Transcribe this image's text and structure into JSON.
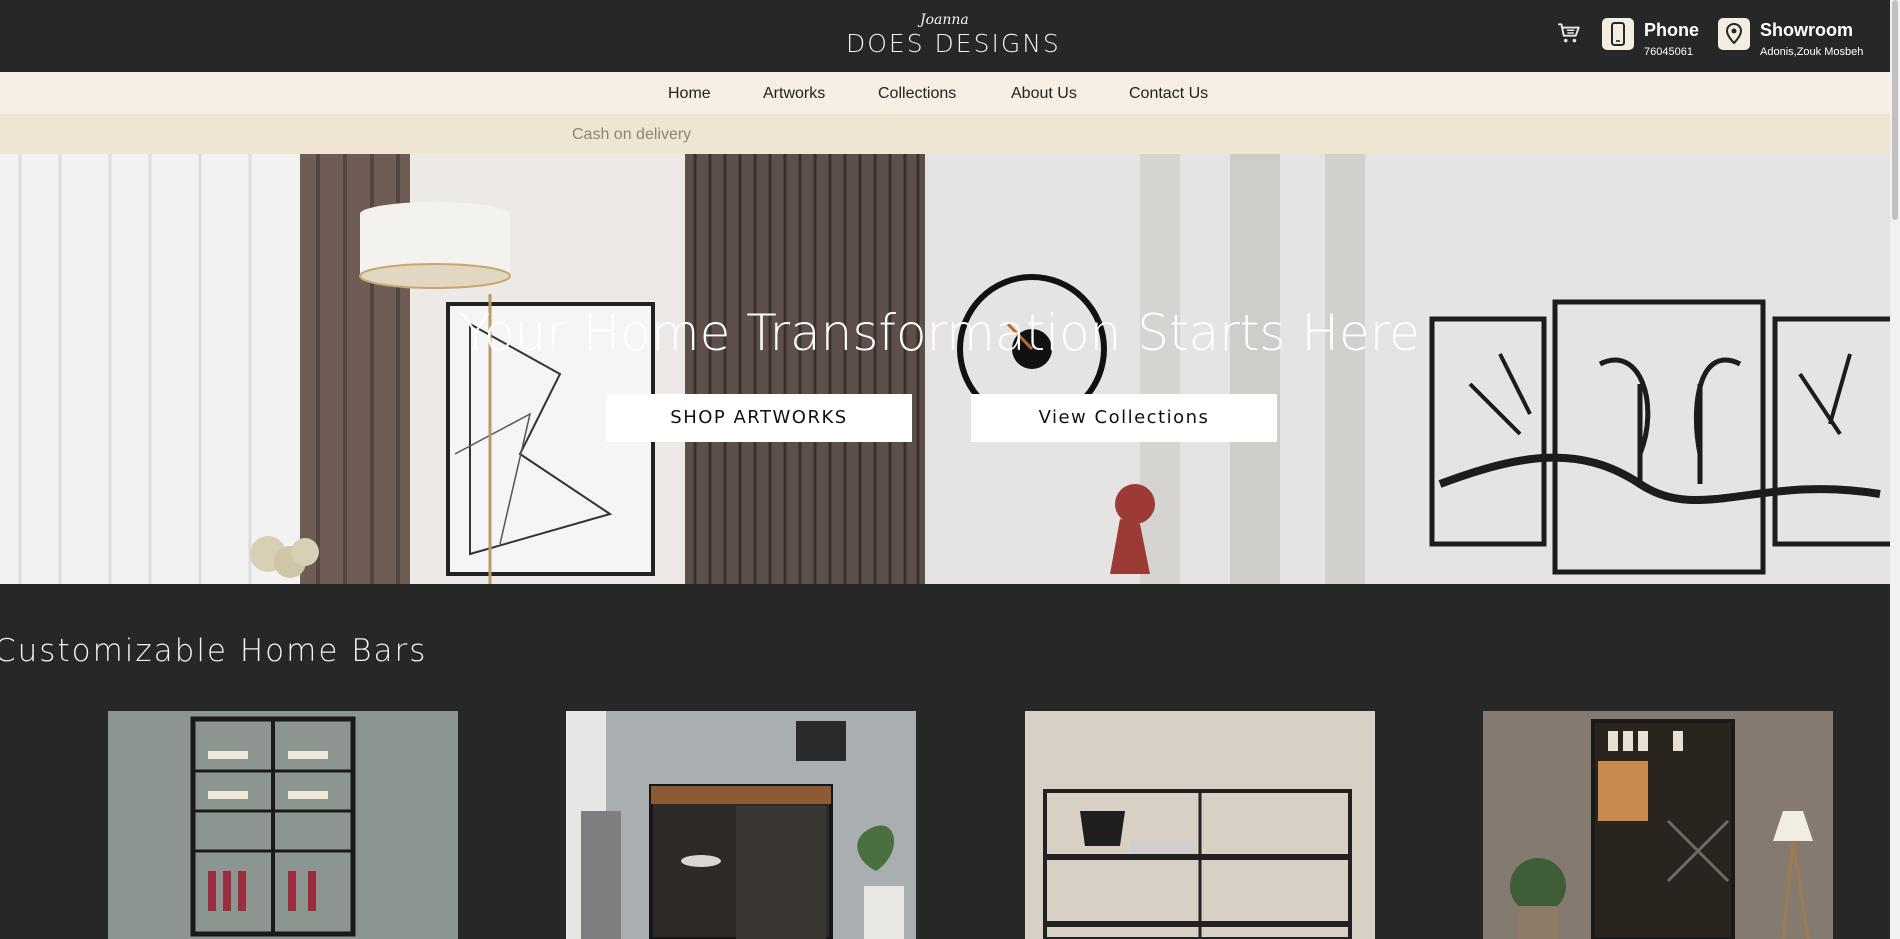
{
  "header": {
    "logo_text": "DOES DESIGNS",
    "logo_script": "Joanna",
    "cart_icon": "cart-icon",
    "phone": {
      "title": "Phone",
      "value": "76045061",
      "icon": "phone-icon"
    },
    "showroom": {
      "title": "Showroom",
      "value": "Adonis,Zouk Mosbeh",
      "icon": "location-pin-icon"
    }
  },
  "nav": {
    "items": [
      {
        "label": "Home"
      },
      {
        "label": "Artworks"
      },
      {
        "label": "Collections"
      },
      {
        "label": "About Us"
      },
      {
        "label": "Contact Us"
      }
    ]
  },
  "announcement": {
    "text": "Cash on delivery"
  },
  "hero": {
    "title": "Your Home Transformation Starts Here",
    "buttons": [
      {
        "label": "SHOP ARTWORKS"
      },
      {
        "label": "View Collections"
      }
    ]
  },
  "section": {
    "title": "Customizable Home Bars",
    "products": [
      {
        "image": "wall-wine-rack-image"
      },
      {
        "image": "bar-cabinet-image"
      },
      {
        "image": "metal-shelf-image"
      },
      {
        "image": "bar-shelving-unit-image"
      }
    ]
  },
  "colors": {
    "header_bg": "#262828",
    "nav_bg": "#f7efe3",
    "announce_bg": "#efe5d3",
    "accent_icon_bg": "#f4ede1"
  }
}
